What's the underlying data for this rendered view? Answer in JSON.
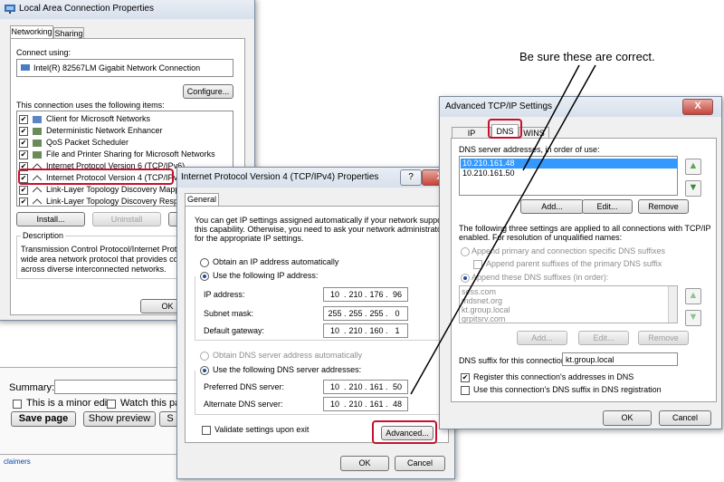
{
  "annotation": "Be sure these are correct.",
  "lac": {
    "title": "Local Area Connection Properties",
    "tabs": [
      "Networking",
      "Sharing"
    ],
    "connect_using_label": "Connect using:",
    "adapter": "Intel(R) 82567LM Gigabit Network Connection",
    "configure": "Configure...",
    "items_label": "This connection uses the following items:",
    "items": [
      {
        "label": "Client for Microsoft Networks",
        "checked": "✔"
      },
      {
        "label": "Deterministic Network Enhancer",
        "checked": "✔"
      },
      {
        "label": "QoS Packet Scheduler",
        "checked": "✔"
      },
      {
        "label": "File and Printer Sharing for Microsoft Networks",
        "checked": "✔"
      },
      {
        "label": "Internet Protocol Version 6 (TCP/IPv6)",
        "checked": "✔"
      },
      {
        "label": "Internet Protocol Version 4 (TCP/IPv4)",
        "checked": "✔"
      },
      {
        "label": "Link-Layer Topology Discovery Mapper",
        "checked": "✔"
      },
      {
        "label": "Link-Layer Topology Discovery Respon",
        "checked": "✔"
      }
    ],
    "install": "Install...",
    "uninstall": "Uninstall",
    "properties": "P",
    "description_label": "Description",
    "description": [
      "Transmission Control Protocol/Internet Protoco",
      "wide area network protocol that provides comm",
      "across diverse interconnected networks."
    ],
    "ok": "OK"
  },
  "wiki": {
    "summary_label": "Summary:",
    "minor_edit": "This is a minor edit",
    "watch": "Watch this pa",
    "save": "Save page",
    "preview": "Show preview",
    "s": "S",
    "footer": "claimers"
  },
  "ipv4": {
    "title": "Internet Protocol Version 4 (TCP/IPv4) Properties",
    "help": "?",
    "close": "X",
    "tab": "General",
    "intro": [
      "You can get IP settings assigned automatically if your network supports",
      "this capability. Otherwise, you need to ask your network administrator",
      "for the appropriate IP settings."
    ],
    "obtain_ip": "Obtain an IP address automatically",
    "use_ip": "Use the following IP address:",
    "ip_label": "IP address:",
    "ip": [
      "10",
      "210",
      "176",
      "96"
    ],
    "mask_label": "Subnet mask:",
    "mask": [
      "255",
      "255",
      "255",
      "0"
    ],
    "gw_label": "Default gateway:",
    "gw": [
      "10",
      "210",
      "160",
      "1"
    ],
    "obtain_dns": "Obtain DNS server address automatically",
    "use_dns": "Use the following DNS server addresses:",
    "pref_label": "Preferred DNS server:",
    "pref": [
      "10",
      "210",
      "161",
      "50"
    ],
    "alt_label": "Alternate DNS server:",
    "alt": [
      "10",
      "210",
      "161",
      "48"
    ],
    "validate": "Validate settings upon exit",
    "advanced": "Advanced...",
    "ok": "OK",
    "cancel": "Cancel"
  },
  "adv": {
    "title": "Advanced TCP/IP Settings",
    "close": "X",
    "tabs": [
      "IP Settings",
      "DNS",
      "WINS"
    ],
    "dns_list_label": "DNS server addresses, in order of use:",
    "dns_list": [
      "10.210.161.48",
      "10.210.161.50"
    ],
    "add": "Add...",
    "edit": "Edit...",
    "remove": "Remove",
    "note": [
      "The following three settings are applied to all connections with TCP/IP",
      "enabled. For resolution of unqualified names:"
    ],
    "append_primary": "Append primary and connection specific DNS suffixes",
    "append_parent": "Append parent suffixes of the primary DNS suffix",
    "append_these": "Append these DNS suffixes (in order):",
    "suffixes": [
      "sess.com",
      "mdsnet.org",
      "kt.group.local",
      "grpitsrv.com"
    ],
    "add2": "Add...",
    "edit2": "Edit...",
    "remove2": "Remove",
    "suffix_label": "DNS suffix for this connection:",
    "suffix_value": "kt.group.local",
    "register": "Register this connection's addresses in DNS",
    "use_suffix": "Use this connection's DNS suffix in DNS registration",
    "ok": "OK",
    "cancel": "Cancel"
  },
  "colors": {
    "highlight": "#c8102e",
    "selection": "#3399ff"
  }
}
